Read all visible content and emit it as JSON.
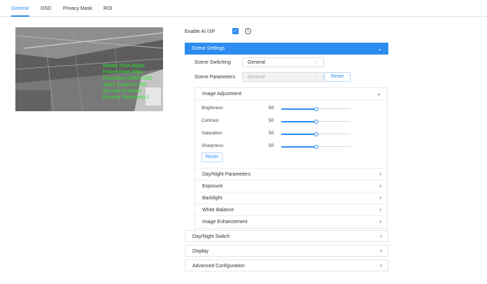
{
  "tabs": [
    {
      "label": "General",
      "active": true
    },
    {
      "label": "OSD",
      "active": false
    },
    {
      "label": "Privacy Mask",
      "active": false
    },
    {
      "label": "ROI",
      "active": false
    }
  ],
  "preview": {
    "osd_lines": [
      "Bitrate:7504.0kbps",
      "Frame Rate:25fps",
      "Resolution:3840*2160",
      "Video Codec:H.265",
      "Encode:Constant",
      "Encode Sharpness:1"
    ],
    "osd_color": "#27e52a"
  },
  "ai_isp": {
    "label": "Enable AI ISP",
    "checked": true,
    "info_icon": "info-icon"
  },
  "scene_settings": {
    "title": "Scene Settings",
    "switching_label": "Scene Switching",
    "switching_value": "General",
    "parameters_label": "Scene Parameters",
    "parameters_value": "General",
    "reset_label": "Reset"
  },
  "image_adjustment": {
    "title": "Image Adjustment",
    "sliders": [
      {
        "label": "Brightness",
        "value": 50
      },
      {
        "label": "Contrast",
        "value": 50
      },
      {
        "label": "Saturation",
        "value": 50
      },
      {
        "label": "Sharpness",
        "value": 50
      }
    ],
    "reset_label": "Reset"
  },
  "sub_sections": [
    "Day/Night Parameters",
    "Exposure",
    "Backlight",
    "White Balance",
    "Image Enhancement"
  ],
  "groups": [
    "Day/Night Switch",
    "Display",
    "Advanced Configuration"
  ],
  "colors": {
    "accent": "#2d8cf0",
    "border": "#e4e6ea"
  }
}
